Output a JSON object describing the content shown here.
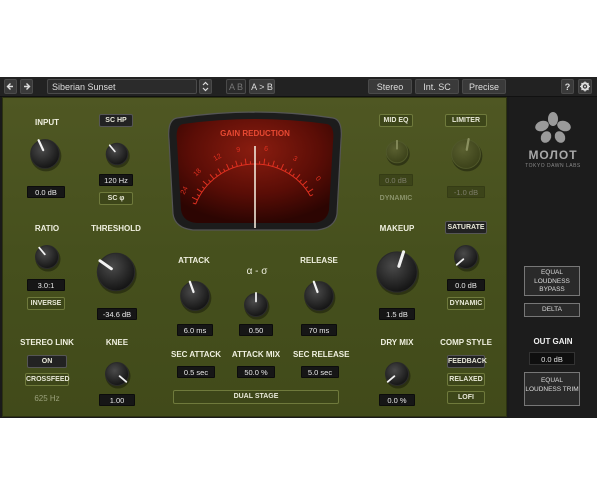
{
  "toolbar": {
    "back_icon": "arrow-left-icon",
    "forward_icon": "arrow-right-icon",
    "preset": "Siberian Sunset",
    "ab_label": "A B",
    "a_to_b_label": "A > B",
    "stereo_label": "Stereo",
    "int_sc_label": "Int. SC",
    "precise_label": "Precise",
    "help_label": "?",
    "settings_icon": "gear-icon"
  },
  "input": {
    "label": "INPUT",
    "value": "0.0 dB"
  },
  "sc_hp": {
    "button": "SC HP",
    "value": "120 Hz",
    "phase_button": "SC φ"
  },
  "meter": {
    "title": "GAIN REDUCTION",
    "scale": [
      "24",
      "18",
      "12",
      "9",
      "6",
      "3",
      "0"
    ],
    "accent": "#e03020"
  },
  "mid_eq": {
    "button": "MID EQ",
    "value": "0.0 dB",
    "dynamic_button": "DYNAMIC"
  },
  "limiter": {
    "button": "LIMITER",
    "value": "-1.0 dB"
  },
  "ratio": {
    "label": "RATIO",
    "value": "3.0:1",
    "inverse_button": "INVERSE"
  },
  "threshold": {
    "label": "THRESHOLD",
    "value": "-34.6 dB"
  },
  "attack": {
    "label": "ATTACK",
    "value": "6.0 ms"
  },
  "alpha_sigma": {
    "label": "α - σ",
    "value": "0.50"
  },
  "release": {
    "label": "RELEASE",
    "value": "70 ms"
  },
  "makeup": {
    "label": "MAKEUP",
    "value": "1.5 dB"
  },
  "saturate": {
    "button": "SATURATE",
    "value": "0.0 dB",
    "dynamic_button": "DYNAMIC"
  },
  "stereo_link": {
    "label": "STEREO LINK",
    "on_button": "ON",
    "crossfeed_button": "CROSSFEED",
    "value": "625 Hz"
  },
  "knee": {
    "label": "KNEE",
    "value": "1.00"
  },
  "sec_attack": {
    "label": "SEC ATTACK",
    "value": "0.5 sec"
  },
  "attack_mix": {
    "label": "ATTACK MIX",
    "value": "50.0 %"
  },
  "sec_release": {
    "label": "SEC RELEASE",
    "value": "5.0 sec"
  },
  "dual_stage": {
    "button": "DUAL STAGE"
  },
  "dry_mix": {
    "label": "DRY MIX",
    "value": "0.0 %"
  },
  "comp_style": {
    "label": "COMP STYLE",
    "options": [
      "FEEDBACK",
      "RELAXED",
      "LOFI"
    ]
  },
  "brand": {
    "logo_icon": "flower-logo-icon",
    "name": "МОЛОТ",
    "sub": "TOKYO DAWN LABS"
  },
  "side": {
    "eq_bypass": "EQUAL LOUDNESS BYPASS",
    "delta": "DELTA",
    "out_gain_label": "OUT GAIN",
    "out_gain_value": "0.0 dB",
    "eq_trim": "EQUAL LOUDNESS TRIM"
  }
}
